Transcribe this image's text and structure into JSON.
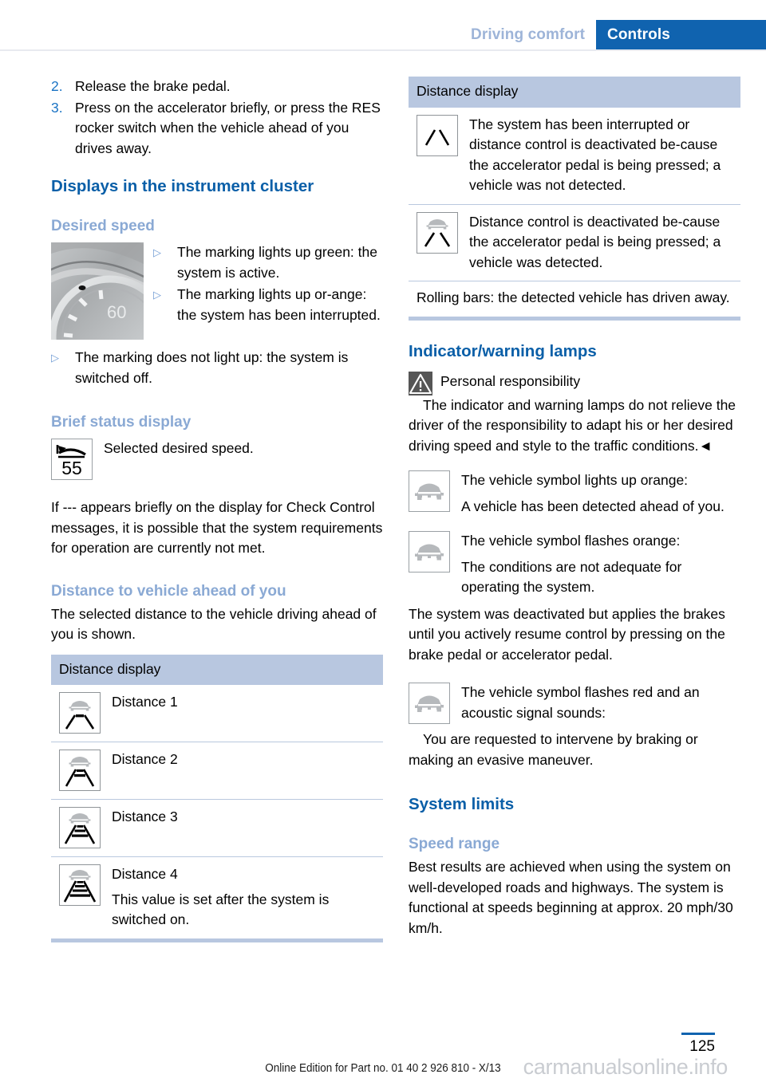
{
  "header": {
    "chapter": "Driving comfort",
    "section": "Controls"
  },
  "left_column": {
    "steps": [
      {
        "num": "2.",
        "text": "Release the brake pedal."
      },
      {
        "num": "3.",
        "text": "Press on the accelerator briefly, or press the RES rocker switch when the vehicle ahead of you drives away."
      }
    ],
    "heading_displays": "Displays in the instrument cluster",
    "subheading_desired_speed": "Desired speed",
    "cluster_image": {
      "icon": "instrument-cluster-dial",
      "speed_label": "60"
    },
    "desired_speed_bullets": [
      {
        "mark": "▷",
        "text": "The marking lights up green: the system is active."
      },
      {
        "mark": "▷",
        "text": "The marking lights up or-ange: the system has been interrupted."
      },
      {
        "mark": "▷",
        "text": "The marking does not light up: the system is switched off."
      }
    ],
    "subheading_brief_status": "Brief status display",
    "brief_status": {
      "icon": "speed-limit-55-icon",
      "badge_value": "55",
      "text": "Selected desired speed."
    },
    "brief_status_para": "If --- appears briefly on the display for Check Control messages, it is possible that the system requirements for operation are currently not met.",
    "subheading_distance": "Distance to vehicle ahead of you",
    "distance_intro": "The selected distance to the vehicle driving ahead of you is shown.",
    "distance_table": {
      "header": "Distance display",
      "rows": [
        {
          "icon": "distance-1-icon",
          "bars": 1,
          "label": "Distance 1"
        },
        {
          "icon": "distance-2-icon",
          "bars": 2,
          "label": "Distance 2"
        },
        {
          "icon": "distance-3-icon",
          "bars": 3,
          "label": "Distance 3"
        },
        {
          "icon": "distance-4-icon",
          "bars": 4,
          "label": "Distance 4",
          "note": "This value is set after the system is switched on."
        }
      ]
    }
  },
  "right_column": {
    "distance_table": {
      "header": "Distance display",
      "rows": [
        {
          "icon": "distance-interrupted-no-vehicle-icon",
          "text": "The system has been interrupted or distance control is deactivated be-cause the accelerator pedal is being pressed; a vehicle was not detected."
        },
        {
          "icon": "distance-deactivated-vehicle-icon",
          "text": "Distance control is deactivated be-cause the accelerator pedal is being pressed; a vehicle was detected."
        }
      ],
      "note": "Rolling bars: the detected vehicle has driven away."
    },
    "heading_lamps": "Indicator/warning lamps",
    "warning": {
      "icon": "warning-triangle-icon",
      "title": "Personal responsibility",
      "text": "The indicator and warning lamps do not relieve the driver of the responsibility to adapt his or her desired driving speed and style to the traffic conditions.◄"
    },
    "lamps": [
      {
        "icon": "vehicle-symbol-orange-icon",
        "title": "The vehicle symbol lights up orange:",
        "text": "A vehicle has been detected ahead of you."
      },
      {
        "icon": "vehicle-symbol-flashing-orange-icon",
        "title": "The vehicle symbol flashes orange:",
        "text": "The conditions are not adequate for operating the system."
      }
    ],
    "lamps_para": "The system was deactivated but applies the brakes until you actively resume control by pressing on the brake pedal or accelerator pedal.",
    "lamp_red": {
      "icon": "vehicle-symbol-red-icon",
      "title": "The vehicle symbol flashes red and an acoustic signal sounds:",
      "text": "You are requested to intervene by braking or making an evasive maneuver."
    },
    "heading_system_limits": "System limits",
    "subheading_speed_range": "Speed range",
    "speed_range_text": "Best results are achieved when using the system on well-developed roads and highways. The system is functional at speeds beginning at approx. 20 mph/30 km/h."
  },
  "footer": {
    "note": "Online Edition for Part no. 01 40 2 926 810 - X/13",
    "watermark": "carmanualsonline.info",
    "page_number": "125"
  },
  "colors": {
    "header_blue": "#1063af",
    "header_chapter_blue": "#9db4d8",
    "heading_blue": "#0a5fa8",
    "subheading_blue": "#8aa9d4",
    "table_header_bg": "#b8c7e0",
    "table_rule": "#b9c8de"
  }
}
